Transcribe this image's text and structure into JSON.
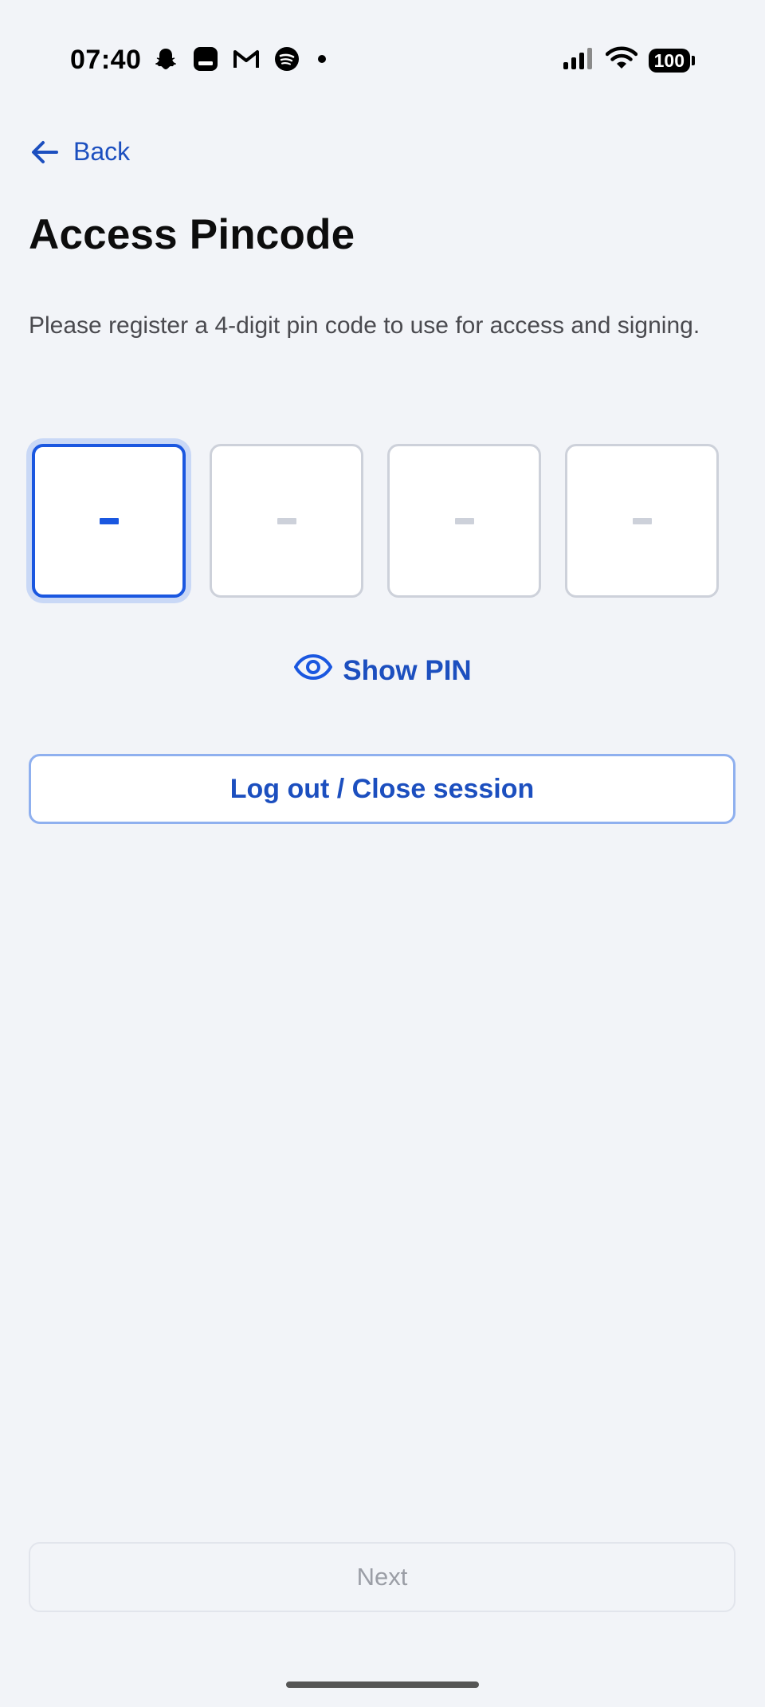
{
  "status_bar": {
    "time": "07:40",
    "left_icons": [
      "snapchat-icon",
      "app-square-icon",
      "gmail-icon",
      "spotify-icon",
      "dot-icon"
    ],
    "right_icons": [
      "cellular-signal-icon",
      "wifi-icon",
      "battery-icon"
    ],
    "battery_level": "100"
  },
  "nav": {
    "back_label": "Back"
  },
  "page": {
    "title": "Access Pincode",
    "description": "Please register a 4-digit pin code to use for access and signing."
  },
  "pin": {
    "length": 4,
    "active_index": 0,
    "placeholder": "-",
    "digits": [
      "",
      "",
      "",
      ""
    ]
  },
  "actions": {
    "show_pin_label": "Show PIN",
    "logout_label": "Log out / Close session",
    "next_label": "Next"
  },
  "colors": {
    "background": "#f2f4f8",
    "accent": "#1c4fbf",
    "active_border": "#1a57e0",
    "inactive_border": "#cdd1da",
    "disabled_text": "#9b9ea6"
  }
}
